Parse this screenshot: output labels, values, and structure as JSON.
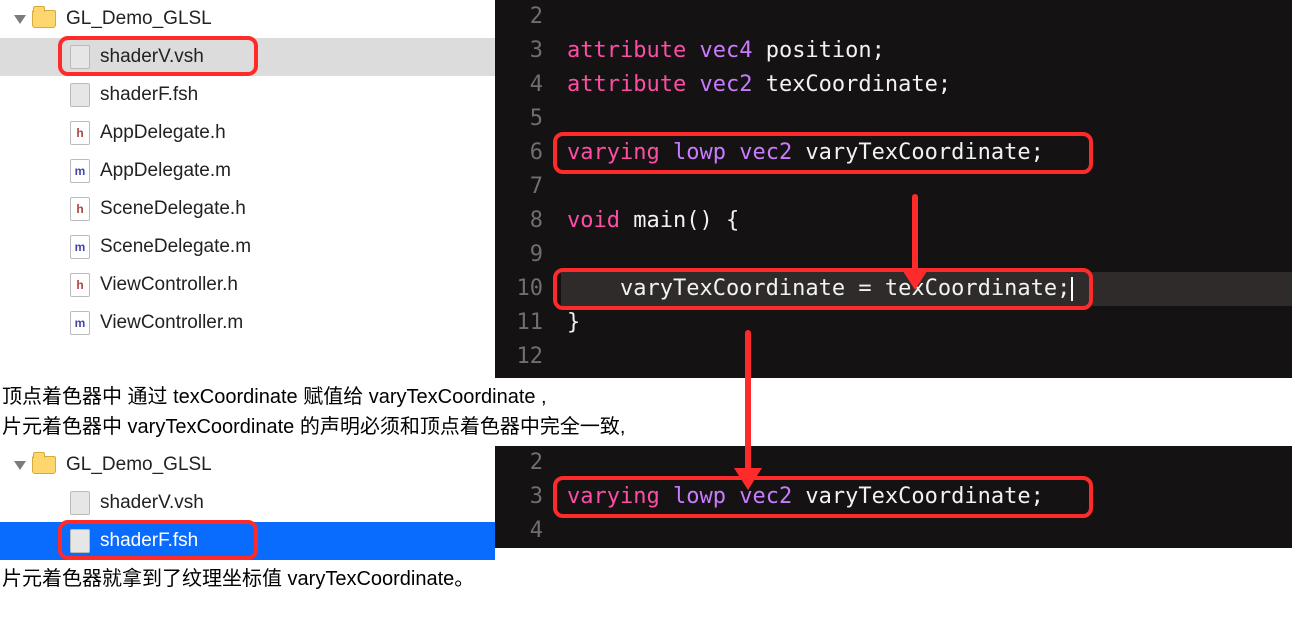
{
  "nav1": {
    "folder": "GL_Demo_GLSL",
    "items": [
      {
        "label": "shaderV.vsh",
        "kind": "shader",
        "selected": "grey",
        "boxed": true
      },
      {
        "label": "shaderF.fsh",
        "kind": "shader"
      },
      {
        "label": "AppDelegate.h",
        "kind": "h"
      },
      {
        "label": "AppDelegate.m",
        "kind": "m"
      },
      {
        "label": "SceneDelegate.h",
        "kind": "h"
      },
      {
        "label": "SceneDelegate.m",
        "kind": "m"
      },
      {
        "label": "ViewController.h",
        "kind": "h"
      },
      {
        "label": "ViewController.m",
        "kind": "m"
      }
    ]
  },
  "nav2": {
    "folder": "GL_Demo_GLSL",
    "items": [
      {
        "label": "shaderV.vsh",
        "kind": "shader"
      },
      {
        "label": "shaderF.fsh",
        "kind": "shader",
        "selected": "blue",
        "boxed": true
      }
    ]
  },
  "editor1": {
    "start": 2,
    "lines": [
      {
        "tokens": []
      },
      {
        "tokens": [
          {
            "t": "attribute",
            "c": "kw"
          },
          {
            "t": " ",
            "c": ""
          },
          {
            "t": "vec4",
            "c": "type"
          },
          {
            "t": " position;",
            "c": "id"
          }
        ]
      },
      {
        "tokens": [
          {
            "t": "attribute",
            "c": "kw"
          },
          {
            "t": " ",
            "c": ""
          },
          {
            "t": "vec2",
            "c": "type"
          },
          {
            "t": " texCoordinate;",
            "c": "id"
          }
        ]
      },
      {
        "tokens": []
      },
      {
        "tokens": [
          {
            "t": "varying",
            "c": "kw"
          },
          {
            "t": " ",
            "c": ""
          },
          {
            "t": "lowp",
            "c": "type"
          },
          {
            "t": " ",
            "c": ""
          },
          {
            "t": "vec2",
            "c": "type"
          },
          {
            "t": " varyTexCoordinate;",
            "c": "id"
          }
        ],
        "boxed": true
      },
      {
        "tokens": []
      },
      {
        "tokens": [
          {
            "t": "void",
            "c": "kw"
          },
          {
            "t": " main() {",
            "c": "fn"
          }
        ]
      },
      {
        "tokens": []
      },
      {
        "tokens": [
          {
            "t": "    varyTexCoordinate = texCoordinate;",
            "c": "id"
          }
        ],
        "hl": true,
        "boxed": true,
        "cursor": true
      },
      {
        "tokens": [
          {
            "t": "}",
            "c": "punc"
          }
        ]
      },
      {
        "tokens": []
      }
    ]
  },
  "editor2": {
    "start": 2,
    "lines": [
      {
        "tokens": []
      },
      {
        "tokens": [
          {
            "t": "varying",
            "c": "kw"
          },
          {
            "t": " ",
            "c": ""
          },
          {
            "t": "lowp",
            "c": "type"
          },
          {
            "t": " ",
            "c": ""
          },
          {
            "t": "vec2",
            "c": "type"
          },
          {
            "t": " varyTexCoordinate;",
            "c": "id"
          }
        ],
        "boxed": true
      },
      {
        "tokens": []
      }
    ]
  },
  "annotation1_line1": "顶点着色器中 通过 texCoordinate 赋值给 varyTexCoordinate ,",
  "annotation1_line2": "片元着色器中 varyTexCoordinate 的声明必须和顶点着色器中完全一致,",
  "annotation2": "片元着色器就拿到了纹理坐标值 varyTexCoordinate。"
}
